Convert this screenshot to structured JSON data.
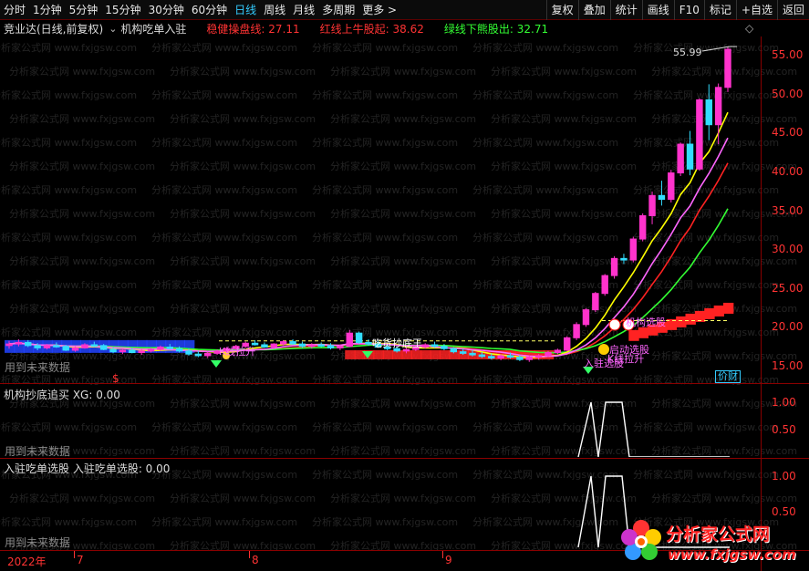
{
  "toolbar": {
    "periods": [
      "分时",
      "1分钟",
      "5分钟",
      "15分钟",
      "30分钟",
      "60分钟",
      "日线",
      "周线",
      "月线",
      "多周期",
      "更多 >"
    ],
    "active_period": "日线",
    "right_buttons": [
      "复权",
      "叠加",
      "统计",
      "画线",
      "F10",
      "标记",
      "+自选",
      "返回"
    ]
  },
  "infobar": {
    "stock": "竞业达(日线,前复权)",
    "formula": "机构吃单入驻",
    "ind1_label": "稳健操盘线:",
    "ind1_value": "27.11",
    "ind1_color": "#ff3333",
    "ind2_label": "红线上牛股起:",
    "ind2_value": "38.62",
    "ind2_color": "#ff3333",
    "ind3_label": "绿线下熊股出:",
    "ind3_value": "32.71",
    "ind3_color": "#33ff33"
  },
  "main_pane": {
    "future_label": "用到未来数据",
    "peak_label": "55.99",
    "dollar_mark": "$",
    "boxed_label": "价财",
    "annotations": [
      {
        "text": "K线拉升",
        "color": "#ff66ff"
      },
      {
        "text": "吃货抄底王",
        "color": "#ffffff"
      },
      {
        "text": "机构选股",
        "color": "#ff66ff"
      },
      {
        "text": "启动选股",
        "color": "#ff66ff"
      },
      {
        "text": "K线拉升",
        "color": "#ff66ff"
      },
      {
        "text": "入驻选股",
        "color": "#ff66ff"
      }
    ]
  },
  "pane1": {
    "title": "机构抄底追买  XG: 0.00",
    "future_label": "用到未来数据"
  },
  "pane2": {
    "title": "入驻吃单选股  入驻吃单选股: 0.00",
    "future_label": "用到未来数据"
  },
  "price_axis": [
    "55.00",
    "50.00",
    "45.00",
    "40.00",
    "35.00",
    "30.00",
    "25.00",
    "20.00",
    "15.00"
  ],
  "ind_axis": [
    "1.00",
    "0.50"
  ],
  "dates": [
    "2022年",
    "7",
    "8",
    "9"
  ],
  "watermark_text": "分析家公式网 www.fxjgsw.com",
  "logo": {
    "title": "分析家公式网",
    "url": "www.fxjgsw.com"
  },
  "chart_data": {
    "type": "candlestick",
    "ylim": [
      13,
      58
    ],
    "peak": 55.99,
    "candles": [
      [
        17.6,
        18.2,
        17.2,
        17.8
      ],
      [
        17.8,
        18.4,
        17.5,
        18.0
      ],
      [
        18.0,
        18.3,
        17.4,
        17.6
      ],
      [
        17.6,
        17.9,
        17.0,
        17.3
      ],
      [
        17.3,
        17.8,
        17.1,
        17.6
      ],
      [
        17.6,
        18.0,
        17.3,
        17.5
      ],
      [
        17.5,
        17.7,
        16.9,
        17.0
      ],
      [
        17.0,
        17.5,
        16.8,
        17.3
      ],
      [
        17.3,
        17.9,
        17.2,
        17.7
      ],
      [
        17.7,
        18.1,
        17.4,
        17.6
      ],
      [
        17.6,
        17.8,
        17.0,
        17.1
      ],
      [
        17.1,
        17.4,
        16.6,
        16.8
      ],
      [
        16.8,
        17.2,
        16.5,
        17.0
      ],
      [
        17.0,
        17.3,
        16.6,
        16.7
      ],
      [
        16.7,
        17.1,
        16.4,
        16.9
      ],
      [
        16.9,
        17.3,
        16.7,
        17.1
      ],
      [
        17.1,
        17.6,
        16.9,
        17.4
      ],
      [
        17.4,
        17.8,
        17.1,
        17.2
      ],
      [
        17.2,
        17.5,
        16.7,
        16.9
      ],
      [
        16.9,
        17.2,
        16.3,
        16.5
      ],
      [
        16.5,
        16.9,
        16.1,
        16.3
      ],
      [
        16.3,
        16.8,
        16.0,
        16.6
      ],
      [
        16.6,
        17.1,
        16.4,
        16.9
      ],
      [
        16.9,
        17.4,
        16.7,
        17.2
      ],
      [
        17.2,
        17.7,
        17.0,
        17.5
      ],
      [
        17.5,
        18.1,
        17.3,
        17.9
      ],
      [
        17.9,
        18.3,
        17.6,
        17.7
      ],
      [
        17.7,
        18.0,
        17.3,
        17.4
      ],
      [
        17.4,
        17.9,
        17.2,
        17.8
      ],
      [
        17.8,
        18.3,
        17.6,
        18.1
      ],
      [
        18.1,
        18.4,
        17.7,
        17.8
      ],
      [
        17.8,
        18.1,
        17.3,
        17.5
      ],
      [
        17.5,
        17.9,
        17.2,
        17.7
      ],
      [
        17.7,
        18.0,
        17.4,
        17.6
      ],
      [
        17.6,
        17.9,
        17.1,
        17.3
      ],
      [
        17.3,
        17.7,
        17.0,
        17.5
      ],
      [
        17.5,
        19.6,
        17.4,
        19.2
      ],
      [
        19.2,
        19.4,
        17.8,
        18.0
      ],
      [
        18.0,
        18.4,
        17.6,
        17.8
      ],
      [
        17.8,
        18.2,
        17.3,
        17.4
      ],
      [
        17.4,
        17.8,
        17.0,
        17.2
      ],
      [
        17.2,
        17.5,
        16.7,
        16.9
      ],
      [
        16.9,
        17.3,
        16.6,
        17.1
      ],
      [
        17.1,
        17.6,
        16.9,
        17.4
      ],
      [
        17.4,
        17.9,
        17.2,
        17.7
      ],
      [
        17.7,
        18.1,
        17.3,
        17.5
      ],
      [
        17.5,
        17.8,
        17.0,
        17.2
      ],
      [
        17.2,
        17.4,
        16.6,
        16.8
      ],
      [
        16.8,
        17.2,
        16.4,
        16.6
      ],
      [
        16.6,
        17.0,
        16.2,
        16.4
      ],
      [
        16.4,
        16.8,
        16.0,
        16.2
      ],
      [
        16.2,
        16.6,
        15.8,
        16.0
      ],
      [
        16.0,
        16.5,
        15.7,
        16.3
      ],
      [
        16.3,
        16.7,
        15.9,
        16.1
      ],
      [
        16.1,
        16.4,
        15.6,
        15.8
      ],
      [
        15.8,
        16.3,
        15.5,
        16.1
      ],
      [
        16.1,
        16.5,
        15.8,
        16.3
      ],
      [
        16.3,
        16.9,
        16.1,
        16.7
      ],
      [
        16.7,
        17.2,
        16.5,
        17.0
      ],
      [
        17.0,
        18.8,
        16.9,
        18.6
      ],
      [
        18.6,
        20.6,
        18.3,
        20.3
      ],
      [
        20.3,
        22.4,
        20.0,
        22.2
      ],
      [
        22.2,
        24.5,
        21.9,
        24.3
      ],
      [
        24.3,
        26.8,
        24.0,
        26.6
      ],
      [
        26.6,
        29.1,
        26.2,
        28.8
      ],
      [
        28.8,
        29.4,
        28.1,
        28.6
      ],
      [
        28.6,
        31.6,
        28.3,
        31.3
      ],
      [
        31.3,
        34.6,
        31.0,
        34.3
      ],
      [
        34.3,
        37.4,
        33.2,
        36.9
      ],
      [
        36.9,
        38.8,
        35.6,
        36.4
      ],
      [
        36.4,
        40.2,
        36.0,
        39.8
      ],
      [
        39.8,
        43.7,
        39.4,
        43.5
      ],
      [
        43.5,
        45.2,
        39.5,
        40.3
      ],
      [
        40.3,
        49.4,
        40.1,
        49.2
      ],
      [
        49.2,
        51.2,
        44.0,
        46.0
      ],
      [
        46.0,
        51.3,
        43.5,
        50.8
      ],
      [
        50.8,
        55.99,
        50.2,
        55.7
      ]
    ]
  }
}
